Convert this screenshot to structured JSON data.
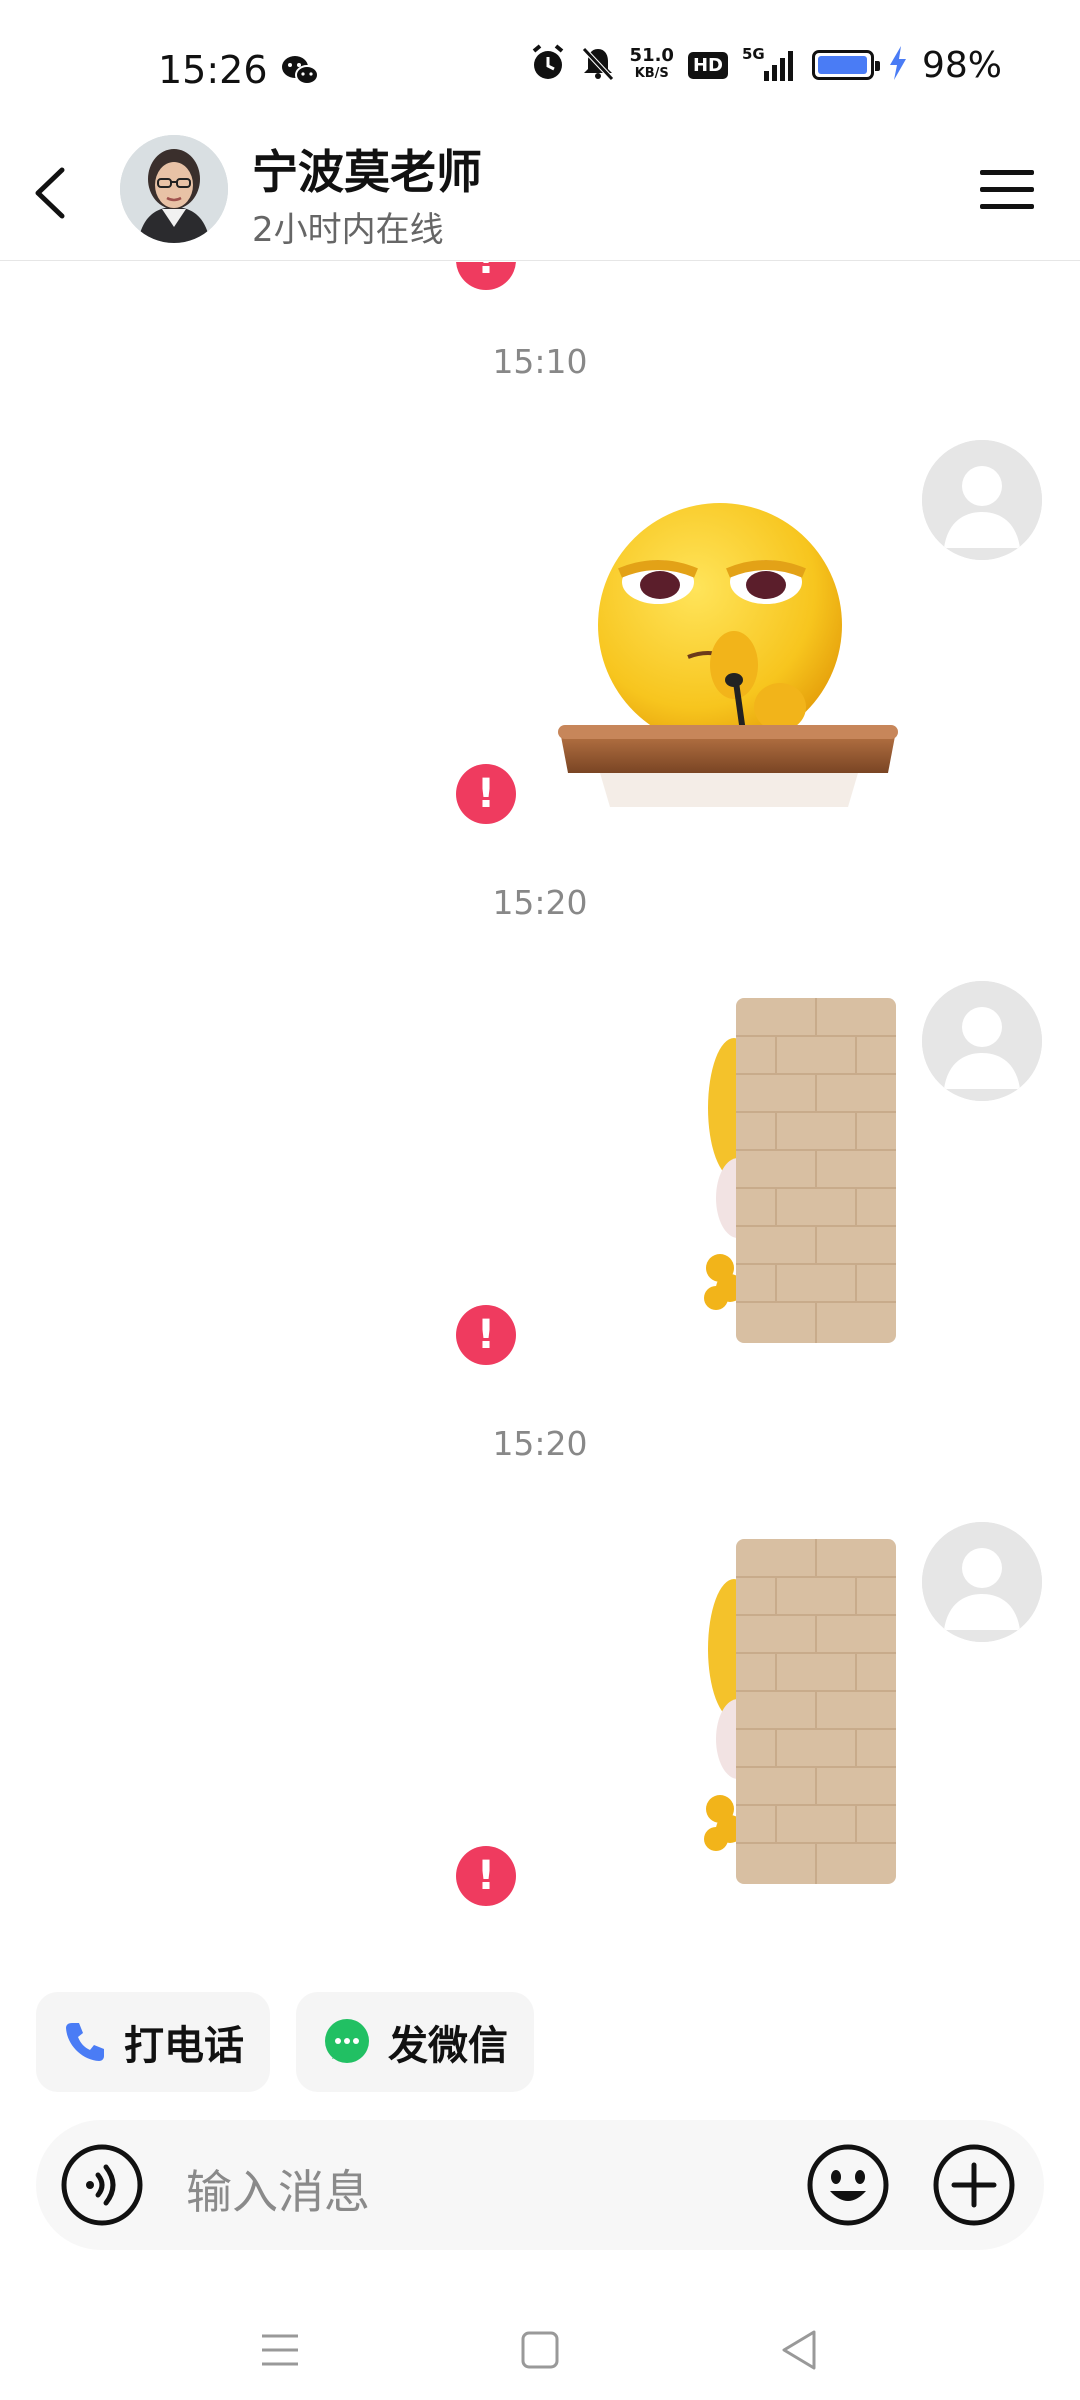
{
  "status_bar": {
    "time": "15:26",
    "network_speed_value": "51.0",
    "network_speed_unit": "KB/S",
    "hd_badge": "HD",
    "signal_type": "5G",
    "battery_percent": "98%",
    "battery_level": 0.98,
    "icons": [
      "wechat-icon",
      "alarm-icon",
      "mute-icon",
      "charging-icon"
    ]
  },
  "header": {
    "contact_name": "宁波莫老师",
    "status_text": "2小时内在线"
  },
  "chat": {
    "messages": [
      {
        "time": "15:10",
        "sticker": "emoji-at-podium",
        "status": "send-failed"
      },
      {
        "time": "15:20",
        "sticker": "peeking-behind-wall",
        "status": "send-failed"
      },
      {
        "time": "15:20",
        "sticker": "peeking-behind-wall",
        "status": "send-failed"
      }
    ],
    "error_symbol": "!"
  },
  "quick_actions": {
    "call_label": "打电话",
    "wechat_label": "发微信"
  },
  "input_bar": {
    "placeholder": "输入消息"
  },
  "colors": {
    "error_red": "#ef3b5f",
    "wechat_green": "#21c063",
    "phone_blue": "#4a7cf5",
    "battery_blue": "#4a7cf5"
  }
}
